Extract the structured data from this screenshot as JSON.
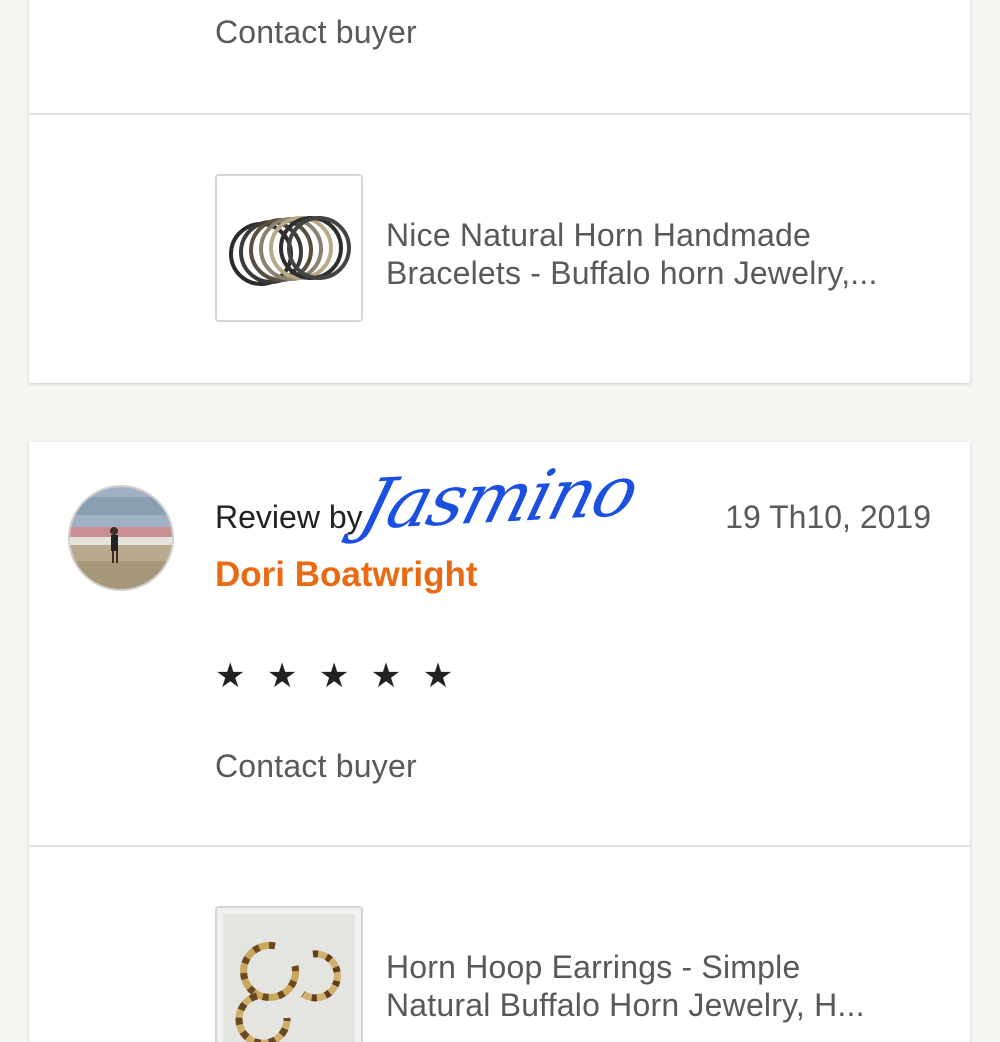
{
  "colors": {
    "page_background": "#f5f5f1",
    "card_background": "#ffffff",
    "reviewer_name": "#e96a12",
    "watermark": "#1b4fe0"
  },
  "review_top": {
    "contact_label": "Contact buyer",
    "listing": {
      "title_line1": "Nice Natural Horn Handmade",
      "title_line2": "Bracelets - Buffalo horn Jewelry,...",
      "image_icon": "bracelets-photo"
    }
  },
  "review_bottom": {
    "review_by_label": "Review by",
    "watermark_signature": "Jasmino",
    "date": "19 Th10, 2019",
    "reviewer_name": "Dori Boatwright",
    "rating": 5,
    "stars_text": "★ ★ ★ ★ ★",
    "contact_label": "Contact buyer",
    "avatar_icon": "reviewer-avatar-photo",
    "listing": {
      "title_line1": "Horn Hoop Earrings - Simple",
      "title_line2": "Natural Buffalo Horn Jewelry, H...",
      "image_icon": "earrings-photo"
    }
  }
}
